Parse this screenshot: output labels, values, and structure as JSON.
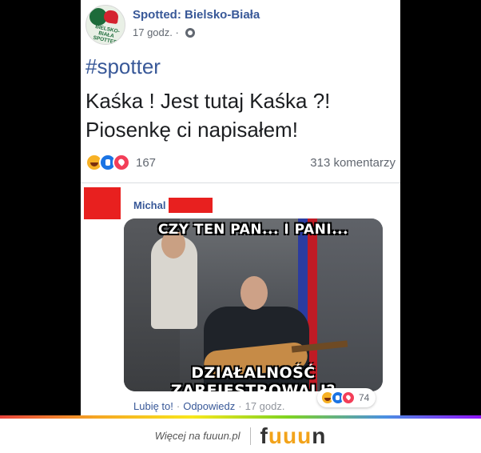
{
  "post": {
    "page_name": "Spotted: Bielsko-Biała",
    "avatar_text": "BIELSKO-BIAŁA SPOTTED",
    "time": "17 godz.",
    "hashtag": "#spotter",
    "text_line1": "Kaśka ! Jest tutaj Kaśka ?!",
    "text_line2": "Piosenkę ci napisałem!",
    "reaction_count": "167",
    "comments_count": "313 komentarzy"
  },
  "comment": {
    "author": "Michal",
    "meme_top": "CZY TEN PAN... I PANI...",
    "meme_bottom": "DZIAŁALNOŚĆ ZAREJESTROWALI?",
    "like_label": "Lubię to!",
    "reply_label": "Odpowiedz",
    "time": "17 godz.",
    "reaction_count": "74"
  },
  "footer": {
    "text": "Więcej na fuuun.pl",
    "logo_f": "f",
    "logo_uuu": "uuu",
    "logo_n": "n"
  },
  "icons": [
    "haha-icon",
    "like-icon",
    "love-icon",
    "globe-icon"
  ],
  "colors": {
    "link_blue": "#385898",
    "redaction_red": "#e8201f",
    "logo_accent": "#f2a31b"
  }
}
